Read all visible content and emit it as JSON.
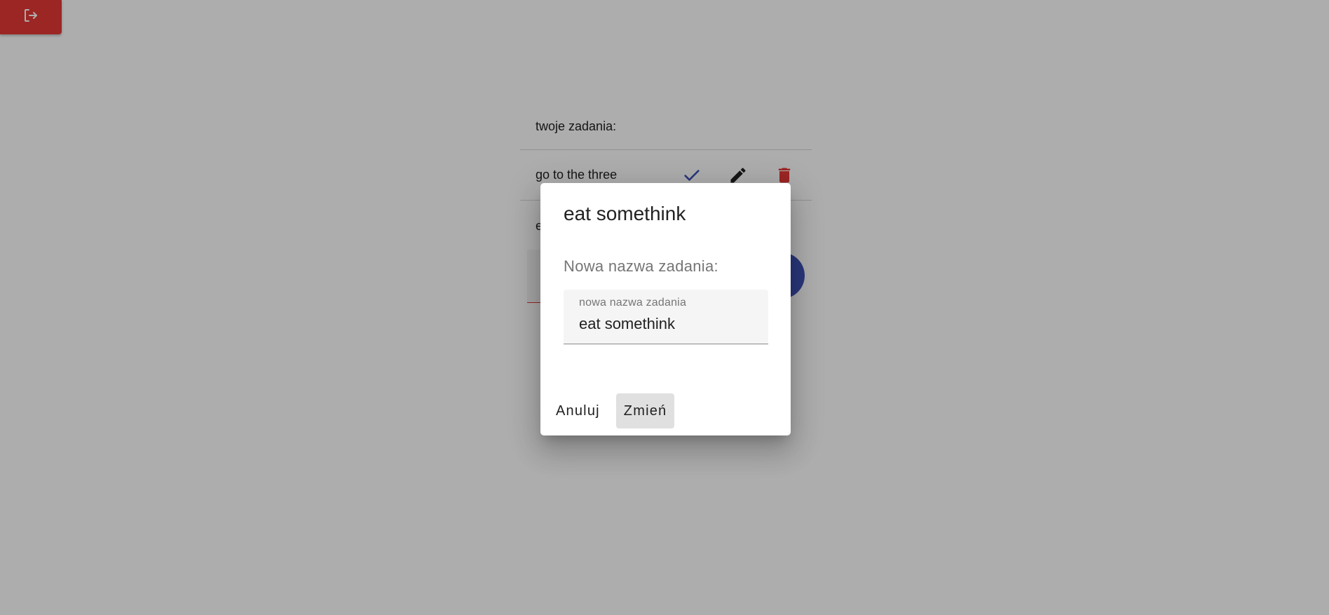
{
  "colors": {
    "logout": "#e53935",
    "accent": "#3f51b5",
    "danger": "#e53935",
    "scrim": "rgba(0,0,0,0.32)"
  },
  "header": {
    "logout_icon": "logout-icon"
  },
  "task_list": {
    "title": "twoje zadania:",
    "items": [
      {
        "text": "go to the three",
        "icons": [
          "check-icon",
          "edit-icon",
          "delete-icon"
        ]
      },
      {
        "text": "e"
      }
    ]
  },
  "dialog": {
    "title": "eat somethink",
    "label": "Nowa nazwa zadania:",
    "field": {
      "floating_label": "nowa nazwa zadania",
      "value": "eat somethink"
    },
    "cancel_label": "Anuluj",
    "confirm_label": "Zmień"
  }
}
